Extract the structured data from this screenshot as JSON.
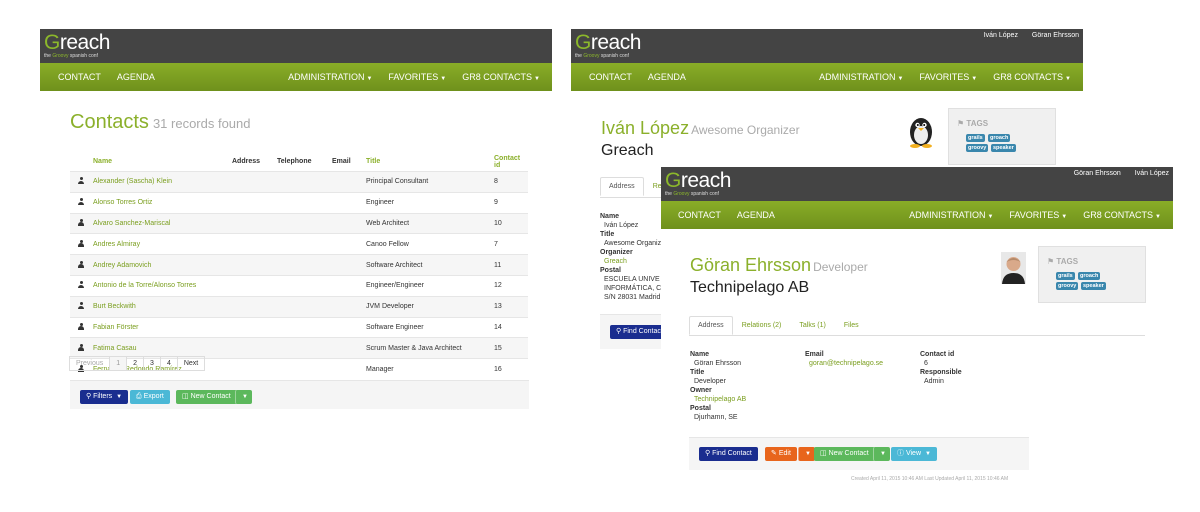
{
  "brand": {
    "name_first": "G",
    "name_rest": "reach",
    "tag_pre": "the ",
    "tag_accent": "Groovy",
    "tag_post": " spanish conf"
  },
  "nav": {
    "left": [
      "CONTACT",
      "AGENDA"
    ],
    "right": [
      "ADMINISTRATION",
      "FAVORITES",
      "GR8 CONTACTS"
    ]
  },
  "top_users_2": [
    "Iván López",
    "Göran Ehrsson"
  ],
  "top_users_3": [
    "Göran Ehrsson",
    "Iván López"
  ],
  "list": {
    "title": "Contacts",
    "records": "31 records found",
    "columns": [
      "Name",
      "Address",
      "Telephone",
      "Email",
      "Title",
      "Contact id"
    ],
    "rows": [
      {
        "name": "Alexander (Sascha) Klein",
        "title": "Principal Consultant",
        "id": "8"
      },
      {
        "name": "Alonso Torres Ortiz",
        "title": "Engineer",
        "id": "9"
      },
      {
        "name": "Alvaro Sanchez-Mariscal",
        "title": "Web Architect",
        "id": "10"
      },
      {
        "name": "Andres Almiray",
        "title": "Canoo Fellow",
        "id": "7"
      },
      {
        "name": "Andrey Adamovich",
        "title": "Software Architect",
        "id": "11"
      },
      {
        "name": "Antonio de la Torre/Alonso Torres",
        "title": "Engineer/Engineer",
        "id": "12"
      },
      {
        "name": "Burt Beckwith",
        "title": "JVM Developer",
        "id": "13"
      },
      {
        "name": "Fabian Förster",
        "title": "Software Engineer",
        "id": "14"
      },
      {
        "name": "Fatima Casau",
        "title": "Scrum Master & Java Architect",
        "id": "15"
      },
      {
        "name": "Fernando Redondo Ramírez",
        "title": "Manager",
        "id": "16"
      }
    ],
    "pager": {
      "prev": "Previous",
      "pages": [
        "1",
        "2",
        "3",
        "4"
      ],
      "next": "Next",
      "current": "1"
    },
    "buttons": {
      "filters": "Filters",
      "export": "Export",
      "new_contact": "New Contact"
    }
  },
  "ivan": {
    "name": "Iván López",
    "role": "Awesome Organizer",
    "company": "Greach",
    "tabs": [
      "Address",
      "Rela"
    ],
    "fields": [
      {
        "label": "Name",
        "value": "Iván López"
      },
      {
        "label": "Title",
        "value": "Awesome Organiz"
      },
      {
        "label": "Organizer",
        "value": "Greach"
      },
      {
        "label": "Postal",
        "value": "ESCUELA UNIVE"
      }
    ],
    "postal_lines": [
      "INFORMÁTICA, C",
      "S/N 28031 Madrid"
    ],
    "find_button": "Find Contac",
    "tags_label": "TAGS",
    "tags": [
      "grails",
      "groach",
      "groovy",
      "speaker"
    ]
  },
  "goran": {
    "name": "Göran Ehrsson",
    "role": "Developer",
    "company": "Technipelago AB",
    "tabs": [
      "Address",
      "Relations (2)",
      "Talks (1)",
      "Files"
    ],
    "col1": [
      {
        "label": "Name",
        "value": "Göran Ehrsson"
      },
      {
        "label": "Title",
        "value": "Developer"
      },
      {
        "label": "Owner",
        "value": "Technipelago AB"
      },
      {
        "label": "Postal",
        "value": "Djurhamn, SE"
      }
    ],
    "col2": [
      {
        "label": "Email",
        "value": "goran@technipelago.se"
      }
    ],
    "col3": [
      {
        "label": "Contact id",
        "value": "6"
      },
      {
        "label": "Responsible",
        "value": "Admin"
      }
    ],
    "buttons": {
      "find": "Find Contact",
      "edit": "Edit",
      "new_contact": "New Contact",
      "view": "View"
    },
    "footer": "Created April 11, 2015 10:46 AM Last Updated April 11, 2015 10:46 AM",
    "tags_label": "TAGS",
    "tags": [
      "grails",
      "groach",
      "groovy",
      "speaker"
    ]
  },
  "colors": {
    "brand_green": "#8bb02b",
    "topbar": "#444444",
    "primary_blue": "#1a2d8f"
  }
}
